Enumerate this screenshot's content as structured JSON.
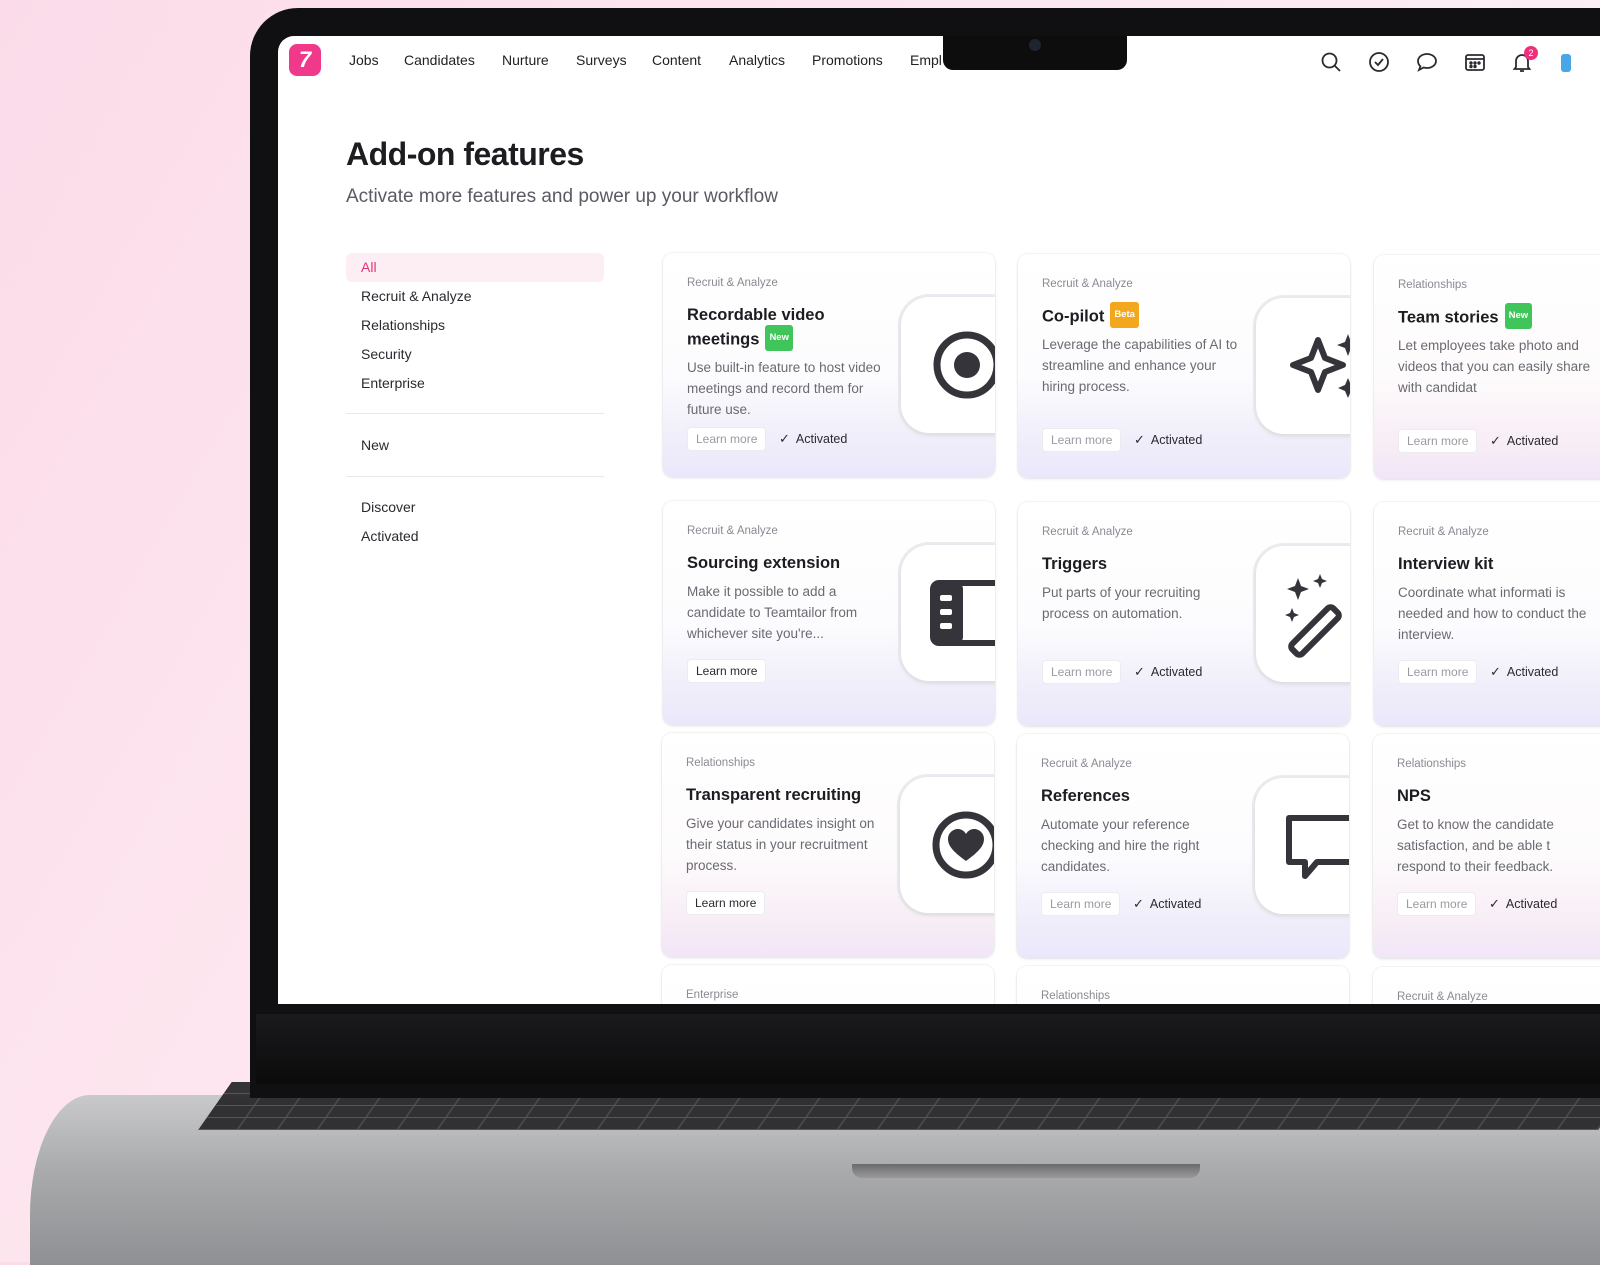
{
  "nav": {
    "items": [
      "Jobs",
      "Candidates",
      "Nurture",
      "Surveys",
      "Content",
      "Analytics",
      "Promotions",
      "Empl"
    ],
    "notification_count": "2"
  },
  "header": {
    "title": "Add-on features",
    "subtitle": "Activate more features and power up your workflow"
  },
  "filters": {
    "group1": [
      "All",
      "Recruit & Analyze",
      "Relationships",
      "Security",
      "Enterprise"
    ],
    "group2": [
      "New"
    ],
    "group3": [
      "Discover",
      "Activated"
    ],
    "active": "All"
  },
  "cards": [
    {
      "category": "Recruit & Analyze",
      "title": "Recordable video meetings",
      "pill": "New",
      "description": "Use built-in feature to host video meetings and record them for future use.",
      "learn_more": "Learn more",
      "status": "Activated",
      "icon": "record-icon"
    },
    {
      "category": "Recruit & Analyze",
      "title": "Co-pilot",
      "pill": "Beta",
      "description": "Leverage the capabilities of AI to streamline and enhance your hiring process.",
      "learn_more": "Learn more",
      "status": "Activated",
      "icon": "sparkle-icon"
    },
    {
      "category": "Relationships",
      "title": "Team stories",
      "pill": "New",
      "description": "Let employees take photo and videos that you can easily share with candidat",
      "learn_more": "Learn more",
      "status": "Activated",
      "icon": ""
    },
    {
      "category": "Recruit & Analyze",
      "title": "Sourcing extension",
      "pill": "",
      "description": "Make it possible to add a candidate to Teamtailor from whichever site you're...",
      "learn_more": "Learn more",
      "status": "",
      "icon": "browser-extension-icon"
    },
    {
      "category": "Recruit & Analyze",
      "title": "Triggers",
      "pill": "",
      "description": "Put parts of your recruiting process on automation.",
      "learn_more": "Learn more",
      "status": "Activated",
      "icon": "magic-wand-icon"
    },
    {
      "category": "Recruit & Analyze",
      "title": "Interview kit",
      "pill": "",
      "description": "Coordinate what informati is needed and how to conduct the interview.",
      "learn_more": "Learn more",
      "status": "Activated",
      "icon": ""
    },
    {
      "category": "Relationships",
      "title": "Transparent recruiting",
      "pill": "",
      "description": "Give your candidates insight on their status in your recruitment process.",
      "learn_more": "Learn more",
      "status": "",
      "icon": "heart-icon"
    },
    {
      "category": "Recruit & Analyze",
      "title": "References",
      "pill": "",
      "description": "Automate your reference checking and hire the right candidates.",
      "learn_more": "Learn more",
      "status": "Activated",
      "icon": "speech-bubble-icon"
    },
    {
      "category": "Relationships",
      "title": "NPS",
      "pill": "",
      "description": "Get to know the candidate satisfaction, and be able t respond to their feedback.",
      "learn_more": "Learn more",
      "status": "Activated",
      "icon": ""
    },
    {
      "category": "Enterprise",
      "title": "",
      "pill": "",
      "description": "",
      "learn_more": "",
      "status": "",
      "icon": ""
    },
    {
      "category": "Relationships",
      "title": "",
      "pill": "",
      "description": "",
      "learn_more": "",
      "status": "",
      "icon": ""
    },
    {
      "category": "Recruit & Analyze",
      "title": "",
      "pill": "",
      "description": "",
      "learn_more": "",
      "status": "",
      "icon": ""
    }
  ],
  "colors": {
    "brand": "#f0398b",
    "active_filter_bg": "#fdeef3",
    "new_pill": "#3fc55a",
    "beta_pill": "#f3a71c"
  }
}
